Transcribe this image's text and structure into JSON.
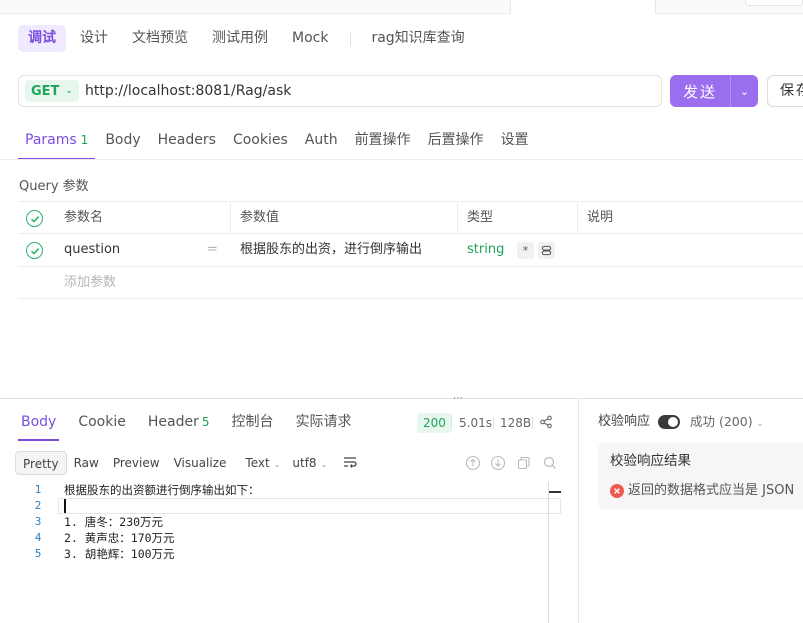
{
  "mode_tabs": [
    "调试",
    "设计",
    "文档预览",
    "测试用例",
    "Mock"
  ],
  "api_name": "rag知识库查询",
  "request": {
    "method": "GET",
    "url": "http://localhost:8081/Rag/ask",
    "send_label": "发送",
    "save_label": "保存"
  },
  "request_tabs": {
    "params_label": "Params",
    "params_count": "1",
    "others": [
      "Body",
      "Headers",
      "Cookies",
      "Auth",
      "前置操作",
      "后置操作",
      "设置"
    ]
  },
  "query_section_title": "Query 参数",
  "params_table": {
    "headers": {
      "name": "参数名",
      "value": "参数值",
      "type": "类型",
      "description": "说明"
    },
    "rows": [
      {
        "name": "question",
        "eq": "=",
        "value": "根据股东的出资，进行倒序输出",
        "type": "string",
        "required_badge": "*"
      }
    ],
    "add_placeholder": "添加参数"
  },
  "response_tabs": {
    "body": "Body",
    "cookie": "Cookie",
    "header": "Header",
    "header_count": "5",
    "console": "控制台",
    "actual_request": "实际请求"
  },
  "response_meta": {
    "status": "200",
    "time": "5.01s",
    "size": "128B"
  },
  "format_toolbar": {
    "buttons": [
      "Pretty",
      "Raw",
      "Preview",
      "Visualize"
    ],
    "text_dropdown": "Text",
    "encoding_dropdown": "utf8"
  },
  "code": {
    "line_numbers": [
      "1",
      "2",
      "3",
      "4",
      "5"
    ],
    "lines": [
      "根据股东的出资额进行倒序输出如下：",
      "",
      "1. 唐冬：230万元",
      "2. 黄声忠：170万元",
      "3. 胡艳辉：100万元"
    ]
  },
  "validation": {
    "toggle_label": "校验响应",
    "toggle_on": true,
    "status_label": "成功 (200)",
    "result_title": "校验响应结果",
    "error_message": "返回的数据格式应当是 JSON"
  },
  "colors": {
    "accent": "#7b4ee0",
    "send_button": "#9b6ef0",
    "success": "#1fa45a",
    "error": "#ee5a52"
  },
  "icons": [
    "chevron-down-icon",
    "check-circle-icon",
    "link-icon",
    "share-icon",
    "wrap-lines-icon",
    "download-icon",
    "upload-icon",
    "copy-icon",
    "search-icon",
    "error-icon"
  ]
}
